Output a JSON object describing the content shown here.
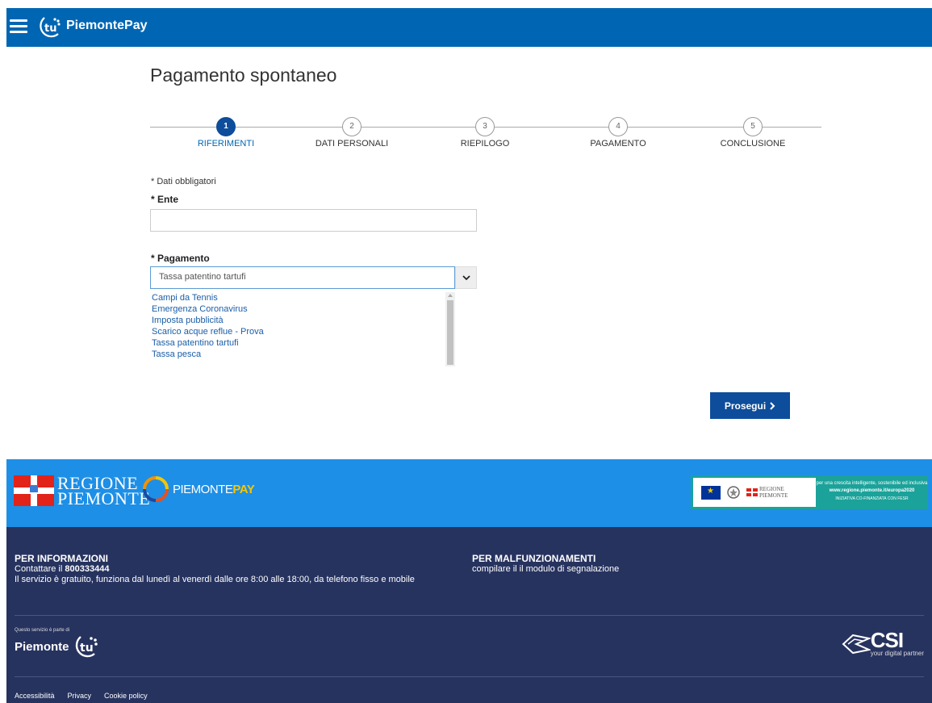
{
  "header": {
    "app_name": "PiemontePay",
    "logo_text": "tu"
  },
  "page": {
    "title": "Pagamento spontaneo"
  },
  "steps": [
    {
      "number": "1",
      "label": "RIFERIMENTI",
      "active": true
    },
    {
      "number": "2",
      "label": "DATI PERSONALI",
      "active": false
    },
    {
      "number": "3",
      "label": "RIEPILOGO",
      "active": false
    },
    {
      "number": "4",
      "label": "PAGAMENTO",
      "active": false
    },
    {
      "number": "5",
      "label": "CONCLUSIONE",
      "active": false
    }
  ],
  "form": {
    "required_note": "* Dati obbligatori",
    "ente_label": "* Ente",
    "ente_value": "",
    "pagamento_label": "* Pagamento",
    "pagamento_selected": "Tassa patentino tartufi",
    "pagamento_options": [
      "Campi da Tennis",
      "Emergenza Coronavirus",
      "Imposta pubblicità",
      "Scarico acque reflue - Prova",
      "Tassa patentino tartufi",
      "Tassa pesca"
    ],
    "next_label": "Prosegui"
  },
  "footer_band": {
    "regione_line1": "REGIONE",
    "regione_line2": "PIEMONTE",
    "piemontepay_text": "PIEMONTE",
    "piemontepay_highlight": "PAY",
    "eu_slogan": "per una crescita intelligente, sostenibile ed inclusiva",
    "eu_url": "www.regione.piemonte.it/europa2020",
    "eu_footnote": "INIZIATIVA CO-FINANZIATA CON FESR",
    "mini_regione": "REGIONE",
    "mini_piemonte": "PIEMONTE"
  },
  "footer": {
    "info_title": "PER INFORMAZIONI",
    "info_contact_prefix": "Contattare il ",
    "info_phone": "800333444",
    "info_hours": "Il servizio è gratuito, funziona dal lunedì al venerdì dalle ore 8:00 alle 18:00, da telefono fisso e mobile",
    "malf_title": "PER MALFUNZIONAMENTI",
    "malf_text": "compilare il il modulo di segnalazione",
    "piemonte_tu_small": "Questo servizio è parte di",
    "piemonte_tu_word": "Piemonte",
    "piemonte_tu_logo": "tu",
    "csi_text": "CSI",
    "csi_sub": "your digital partner",
    "links": [
      "Accessibilità",
      "Privacy",
      "Cookie policy"
    ]
  }
}
